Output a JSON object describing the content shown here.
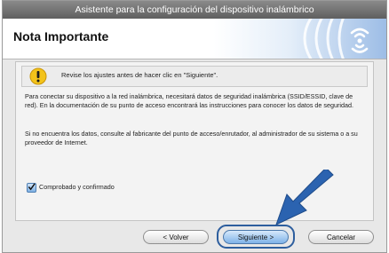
{
  "window": {
    "title": "Asistente para la configuración del dispositivo inalámbrico"
  },
  "header": {
    "title": "Nota Importante",
    "logo_icon": "wifi-icon"
  },
  "notice": {
    "icon": "warning-icon",
    "text": "Revise los ajustes antes de hacer clic en \"Siguiente\"."
  },
  "body": {
    "paragraph1": "Para conectar su dispositivo a la red inalámbrica, necesitará datos de seguridad inalámbrica (SSID/ESSID, clave de red). En la documentación de su punto de acceso encontrará las instrucciones para conocer los datos de seguridad.",
    "paragraph2": "Si no encuentra los datos, consulte al fabricante del punto de acceso/enrutador, al administrador de su sistema o a su proveedor de Internet."
  },
  "checkbox": {
    "label": "Comprobado y confirmado",
    "checked": true
  },
  "buttons": {
    "back": "< Volver",
    "next": "Siguiente >",
    "cancel": "Cancelar"
  },
  "colors": {
    "accent": "#2d5e9e",
    "arrow": "#2b63b0"
  }
}
